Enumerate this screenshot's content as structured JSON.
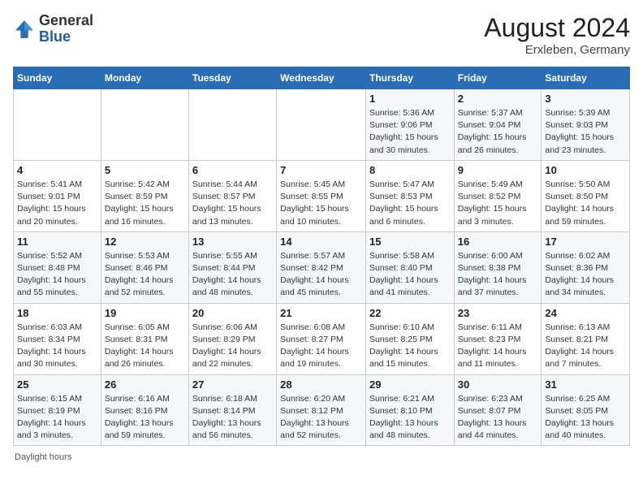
{
  "header": {
    "logo_general": "General",
    "logo_blue": "Blue",
    "month_year": "August 2024",
    "location": "Erxleben, Germany"
  },
  "days_of_week": [
    "Sunday",
    "Monday",
    "Tuesday",
    "Wednesday",
    "Thursday",
    "Friday",
    "Saturday"
  ],
  "footer": {
    "note": "Daylight hours"
  },
  "weeks": [
    [
      {
        "num": "",
        "info": ""
      },
      {
        "num": "",
        "info": ""
      },
      {
        "num": "",
        "info": ""
      },
      {
        "num": "",
        "info": ""
      },
      {
        "num": "1",
        "info": "Sunrise: 5:36 AM\nSunset: 9:06 PM\nDaylight: 15 hours\nand 30 minutes."
      },
      {
        "num": "2",
        "info": "Sunrise: 5:37 AM\nSunset: 9:04 PM\nDaylight: 15 hours\nand 26 minutes."
      },
      {
        "num": "3",
        "info": "Sunrise: 5:39 AM\nSunset: 9:03 PM\nDaylight: 15 hours\nand 23 minutes."
      }
    ],
    [
      {
        "num": "4",
        "info": "Sunrise: 5:41 AM\nSunset: 9:01 PM\nDaylight: 15 hours\nand 20 minutes."
      },
      {
        "num": "5",
        "info": "Sunrise: 5:42 AM\nSunset: 8:59 PM\nDaylight: 15 hours\nand 16 minutes."
      },
      {
        "num": "6",
        "info": "Sunrise: 5:44 AM\nSunset: 8:57 PM\nDaylight: 15 hours\nand 13 minutes."
      },
      {
        "num": "7",
        "info": "Sunrise: 5:45 AM\nSunset: 8:55 PM\nDaylight: 15 hours\nand 10 minutes."
      },
      {
        "num": "8",
        "info": "Sunrise: 5:47 AM\nSunset: 8:53 PM\nDaylight: 15 hours\nand 6 minutes."
      },
      {
        "num": "9",
        "info": "Sunrise: 5:49 AM\nSunset: 8:52 PM\nDaylight: 15 hours\nand 3 minutes."
      },
      {
        "num": "10",
        "info": "Sunrise: 5:50 AM\nSunset: 8:50 PM\nDaylight: 14 hours\nand 59 minutes."
      }
    ],
    [
      {
        "num": "11",
        "info": "Sunrise: 5:52 AM\nSunset: 8:48 PM\nDaylight: 14 hours\nand 55 minutes."
      },
      {
        "num": "12",
        "info": "Sunrise: 5:53 AM\nSunset: 8:46 PM\nDaylight: 14 hours\nand 52 minutes."
      },
      {
        "num": "13",
        "info": "Sunrise: 5:55 AM\nSunset: 8:44 PM\nDaylight: 14 hours\nand 48 minutes."
      },
      {
        "num": "14",
        "info": "Sunrise: 5:57 AM\nSunset: 8:42 PM\nDaylight: 14 hours\nand 45 minutes."
      },
      {
        "num": "15",
        "info": "Sunrise: 5:58 AM\nSunset: 8:40 PM\nDaylight: 14 hours\nand 41 minutes."
      },
      {
        "num": "16",
        "info": "Sunrise: 6:00 AM\nSunset: 8:38 PM\nDaylight: 14 hours\nand 37 minutes."
      },
      {
        "num": "17",
        "info": "Sunrise: 6:02 AM\nSunset: 8:36 PM\nDaylight: 14 hours\nand 34 minutes."
      }
    ],
    [
      {
        "num": "18",
        "info": "Sunrise: 6:03 AM\nSunset: 8:34 PM\nDaylight: 14 hours\nand 30 minutes."
      },
      {
        "num": "19",
        "info": "Sunrise: 6:05 AM\nSunset: 8:31 PM\nDaylight: 14 hours\nand 26 minutes."
      },
      {
        "num": "20",
        "info": "Sunrise: 6:06 AM\nSunset: 8:29 PM\nDaylight: 14 hours\nand 22 minutes."
      },
      {
        "num": "21",
        "info": "Sunrise: 6:08 AM\nSunset: 8:27 PM\nDaylight: 14 hours\nand 19 minutes."
      },
      {
        "num": "22",
        "info": "Sunrise: 6:10 AM\nSunset: 8:25 PM\nDaylight: 14 hours\nand 15 minutes."
      },
      {
        "num": "23",
        "info": "Sunrise: 6:11 AM\nSunset: 8:23 PM\nDaylight: 14 hours\nand 11 minutes."
      },
      {
        "num": "24",
        "info": "Sunrise: 6:13 AM\nSunset: 8:21 PM\nDaylight: 14 hours\nand 7 minutes."
      }
    ],
    [
      {
        "num": "25",
        "info": "Sunrise: 6:15 AM\nSunset: 8:19 PM\nDaylight: 14 hours\nand 3 minutes."
      },
      {
        "num": "26",
        "info": "Sunrise: 6:16 AM\nSunset: 8:16 PM\nDaylight: 13 hours\nand 59 minutes."
      },
      {
        "num": "27",
        "info": "Sunrise: 6:18 AM\nSunset: 8:14 PM\nDaylight: 13 hours\nand 56 minutes."
      },
      {
        "num": "28",
        "info": "Sunrise: 6:20 AM\nSunset: 8:12 PM\nDaylight: 13 hours\nand 52 minutes."
      },
      {
        "num": "29",
        "info": "Sunrise: 6:21 AM\nSunset: 8:10 PM\nDaylight: 13 hours\nand 48 minutes."
      },
      {
        "num": "30",
        "info": "Sunrise: 6:23 AM\nSunset: 8:07 PM\nDaylight: 13 hours\nand 44 minutes."
      },
      {
        "num": "31",
        "info": "Sunrise: 6:25 AM\nSunset: 8:05 PM\nDaylight: 13 hours\nand 40 minutes."
      }
    ]
  ]
}
